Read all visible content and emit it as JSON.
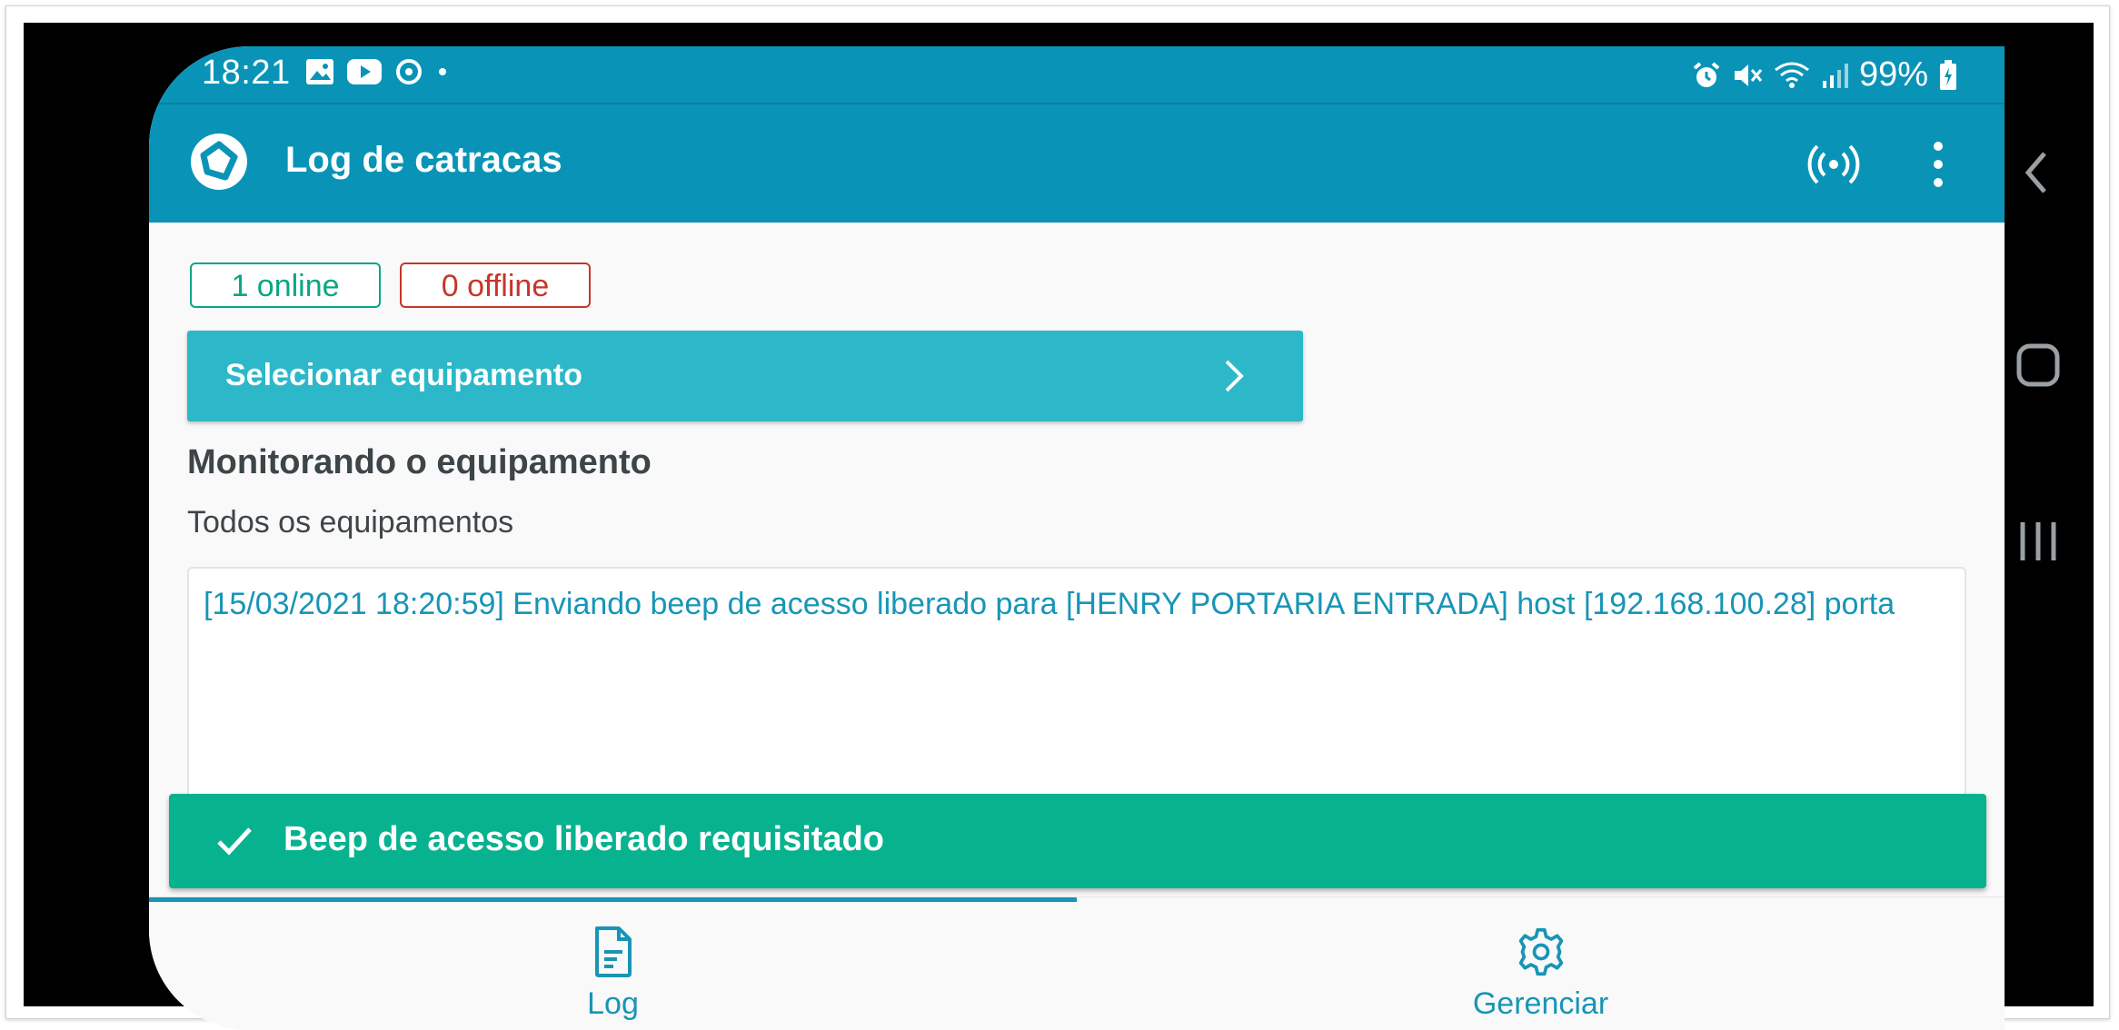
{
  "status_bar": {
    "time": "18:21",
    "battery": "99%",
    "left_icons": [
      "gallery-icon",
      "youtube-icon",
      "sync-icon",
      "dot-icon"
    ],
    "right_icons": [
      "alarm-icon",
      "mute-icon",
      "wifi-icon",
      "signal-icon",
      "battery-charging-icon"
    ]
  },
  "app_bar": {
    "title": "Log de catracas",
    "actions": [
      "broadcast-icon",
      "more-vert-icon"
    ]
  },
  "badges": {
    "online": "1 online",
    "offline": "0 offline"
  },
  "select_button": {
    "label": "Selecionar equipamento"
  },
  "monitoring": {
    "title": "Monitorando o equipamento",
    "subtitle": "Todos os equipamentos"
  },
  "log": {
    "lines": [
      "[15/03/2021 18:20:59] Enviando beep de acesso liberado para [HENRY PORTARIA ENTRADA] host [192.168.100.28] porta"
    ]
  },
  "toast": {
    "message": "Beep de acesso liberado requisitado"
  },
  "bottom_nav": {
    "items": [
      {
        "label": "Log",
        "icon": "document-icon",
        "active": true
      },
      {
        "label": "Gerenciar",
        "icon": "gear-icon",
        "active": false
      }
    ]
  },
  "colors": {
    "primary": "#0994b7",
    "accent": "#2cb8c8",
    "online": "#0aa585",
    "offline": "#c6362b",
    "toast": "#07b28f",
    "link": "#1895b6"
  }
}
